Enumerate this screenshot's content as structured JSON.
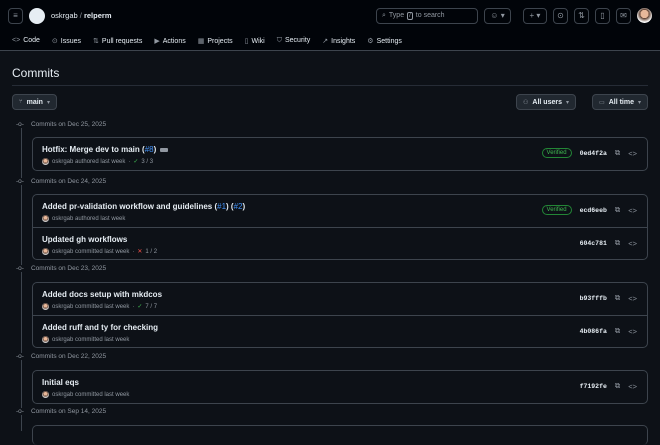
{
  "header": {
    "owner": "oskrgab",
    "repo": "relperm",
    "search_prefix": "Type",
    "search_key": "/",
    "search_suffix": "to search"
  },
  "nav": [
    {
      "icon": "<>",
      "label": "Code"
    },
    {
      "icon": "⊙",
      "label": "Issues"
    },
    {
      "icon": "⇅",
      "label": "Pull requests"
    },
    {
      "icon": "▶",
      "label": "Actions"
    },
    {
      "icon": "▦",
      "label": "Projects"
    },
    {
      "icon": "▯",
      "label": "Wiki"
    },
    {
      "icon": "⛉",
      "label": "Security"
    },
    {
      "icon": "↗",
      "label": "Insights"
    },
    {
      "icon": "⚙",
      "label": "Settings"
    }
  ],
  "page": {
    "title": "Commits",
    "branch": "main",
    "users_filter": "All users",
    "time_filter": "All time"
  },
  "groups": [
    {
      "label": "Commits on Dec 25, 2025",
      "commits": [
        {
          "title": "Hotfix: Merge dev to main (",
          "refs": [
            "#8"
          ],
          "meta": "oskrgab authored last week",
          "checks": "3 / 3",
          "status": "ok",
          "verified": "Verified",
          "sha": "0ed4f2a"
        }
      ]
    },
    {
      "label": "Commits on Dec 24, 2025",
      "commits": [
        {
          "title": "Added pr-validation workflow and guidelines (",
          "refs": [
            "#1",
            "#2"
          ],
          "meta": "oskrgab authored last week",
          "verified": "Verified",
          "sha": "ecd6eeb"
        },
        {
          "title": "Updated gh workflows",
          "meta": "oskrgab committed last week",
          "checks": "1 / 2",
          "status": "bad",
          "sha": "604c781"
        }
      ]
    },
    {
      "label": "Commits on Dec 23, 2025",
      "commits": [
        {
          "title": "Added docs setup with mkdcos",
          "meta": "oskrgab committed last week",
          "checks": "7 / 7",
          "status": "ok",
          "sha": "b93fffb"
        },
        {
          "title": "Added ruff and ty for checking",
          "meta": "oskrgab committed last week",
          "sha": "4b086fa"
        }
      ]
    },
    {
      "label": "Commits on Dec 22, 2025",
      "commits": [
        {
          "title": "Initial eqs",
          "meta": "oskrgab committed last week",
          "sha": "f7192fe"
        }
      ]
    },
    {
      "label": "Commits on Sep 14, 2025",
      "commits": []
    }
  ]
}
